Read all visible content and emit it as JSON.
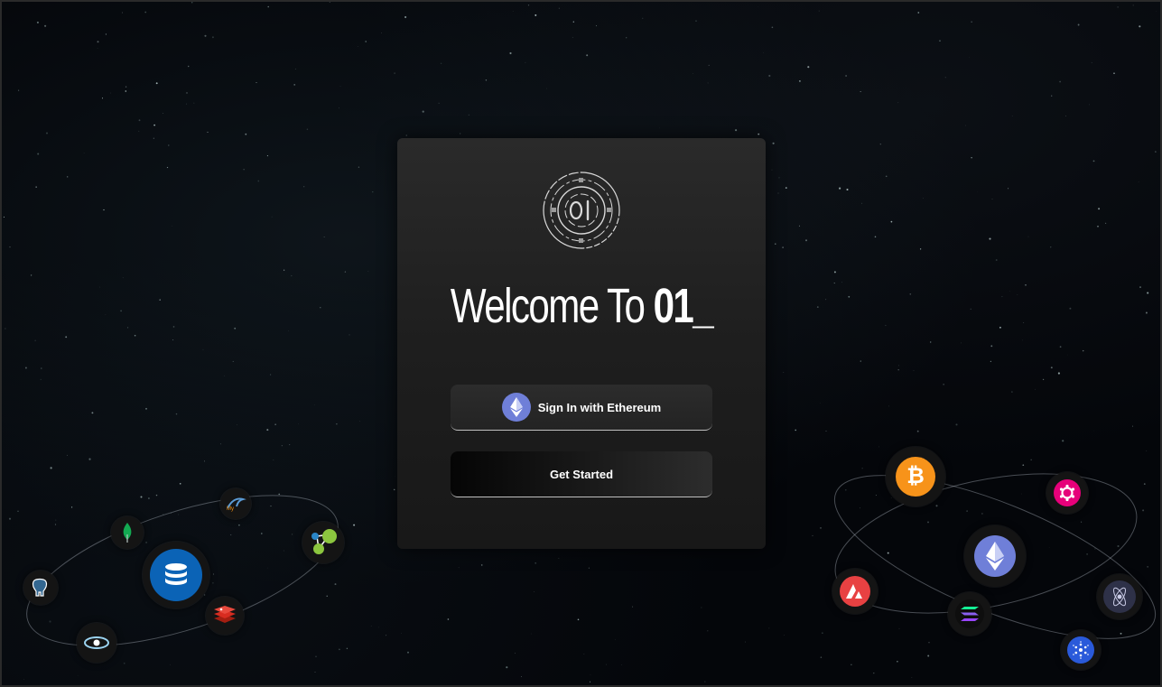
{
  "welcome": {
    "prefix": "Welcome To ",
    "brand": "01_"
  },
  "buttons": {
    "sign_in": "Sign In with Ethereum",
    "get_started": "Get Started"
  },
  "icons": {
    "database_orbit": [
      "postgresql-icon",
      "mongodb-icon",
      "mysql-icon",
      "neo4j-icon",
      "database-icon",
      "redis-icon",
      "cassandra-icon"
    ],
    "crypto_orbit": [
      "bitcoin-icon",
      "polkadot-icon",
      "ethereum-icon",
      "avalanche-icon",
      "solana-icon",
      "cosmos-icon",
      "cardano-icon"
    ]
  },
  "colors": {
    "bitcoin": "#f7931a",
    "polkadot": "#e6007a",
    "ethereum": "#6f7fd8",
    "avalanche": "#e84142",
    "cardano": "#2a5ada"
  }
}
